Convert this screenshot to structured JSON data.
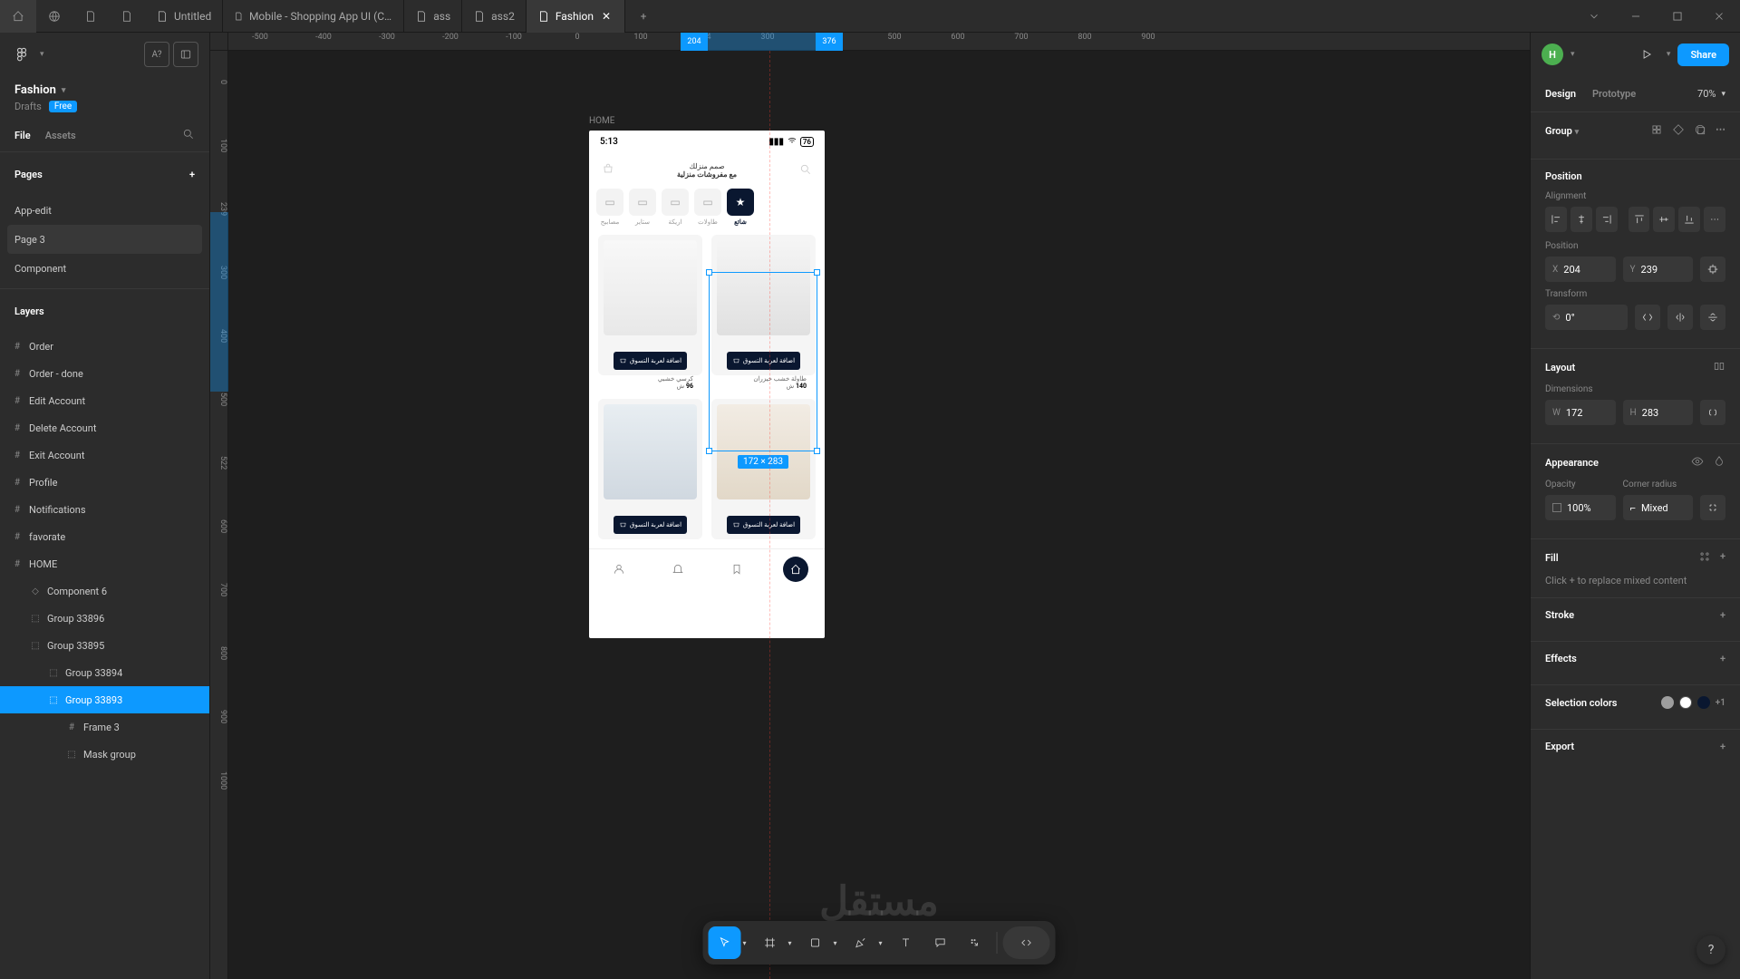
{
  "titlebar": {
    "tabs": [
      {
        "label": "Untitled"
      },
      {
        "label": "Mobile - Shopping App UI (Community)"
      },
      {
        "label": "ass"
      },
      {
        "label": "ass2"
      },
      {
        "label": "Fashion",
        "active": true
      }
    ]
  },
  "left": {
    "filename": "Fashion",
    "drafts": "Drafts",
    "free": "Free",
    "tabs": {
      "file": "File",
      "assets": "Assets"
    },
    "pages_header": "Pages",
    "pages": [
      {
        "label": "App-edit"
      },
      {
        "label": "Page 3",
        "selected": true
      },
      {
        "label": "Component"
      }
    ],
    "layers_header": "Layers",
    "layers": [
      {
        "label": "Order",
        "icon": "frame"
      },
      {
        "label": "Order - done",
        "icon": "frame"
      },
      {
        "label": "Edit Account",
        "icon": "frame"
      },
      {
        "label": "Delete Account",
        "icon": "frame"
      },
      {
        "label": "Exit Account",
        "icon": "frame"
      },
      {
        "label": "Profile",
        "icon": "frame"
      },
      {
        "label": "Notifications",
        "icon": "frame"
      },
      {
        "label": "favorate",
        "icon": "frame"
      },
      {
        "label": "HOME",
        "icon": "frame"
      },
      {
        "label": "Component 6",
        "icon": "component",
        "indent": 1
      },
      {
        "label": "Group 33896",
        "icon": "group",
        "indent": 1
      },
      {
        "label": "Group 33895",
        "icon": "group",
        "indent": 1
      },
      {
        "label": "Group 33894",
        "icon": "group",
        "indent": 2
      },
      {
        "label": "Group 33893",
        "icon": "group",
        "indent": 2,
        "selected": true
      },
      {
        "label": "Frame 3",
        "icon": "frame",
        "indent": 3
      },
      {
        "label": "Mask group",
        "icon": "group",
        "indent": 3
      }
    ]
  },
  "canvas": {
    "frame_label": "HOME",
    "h_ticks": [
      "-500",
      "-400",
      "-300",
      "-200",
      "-100",
      "0",
      "100",
      "204",
      "300",
      "376",
      "500",
      "600",
      "700",
      "800",
      "900"
    ],
    "v_ticks": [
      "0",
      "100",
      "239",
      "300",
      "400",
      "500",
      "522",
      "600",
      "700",
      "800",
      "900",
      "1000"
    ],
    "selection_dim": "172 × 283",
    "watermark": "مستقل"
  },
  "mockup": {
    "time": "5:13",
    "battery": "76",
    "header_line1": "صمم منزلك",
    "header_line2": "مع مفروشات منزلية",
    "categories": [
      {
        "label": "شائع",
        "active": true
      },
      {
        "label": "طاولات"
      },
      {
        "label": "اريكة"
      },
      {
        "label": "ستاير"
      },
      {
        "label": "مصابيح"
      }
    ],
    "add_cart": "اضافة لعربة التسوق",
    "products": [
      {
        "name": "كرسي خشبي",
        "price": "96",
        "currency": "ش"
      },
      {
        "name": "طاولة خشب خيزران",
        "price": "140",
        "currency": "ش"
      }
    ]
  },
  "right": {
    "avatar": "H",
    "share": "Share",
    "tabs": {
      "design": "Design",
      "prototype": "Prototype"
    },
    "zoom": "70%",
    "group_label": "Group",
    "position": {
      "header": "Position",
      "alignment": "Alignment",
      "pos_label": "Position",
      "x": "204",
      "y": "239",
      "transform": "Transform",
      "rotation": "0°"
    },
    "layout": {
      "header": "Layout",
      "dimensions": "Dimensions",
      "w": "172",
      "h": "283"
    },
    "appearance": {
      "header": "Appearance",
      "opacity_label": "Opacity",
      "opacity": "100%",
      "corner_label": "Corner radius",
      "corner": "Mixed"
    },
    "fill": {
      "header": "Fill",
      "hint": "Click + to replace mixed content"
    },
    "stroke": "Stroke",
    "effects": "Effects",
    "selection_colors": "Selection colors",
    "selection_more": "+1",
    "export": "Export"
  }
}
